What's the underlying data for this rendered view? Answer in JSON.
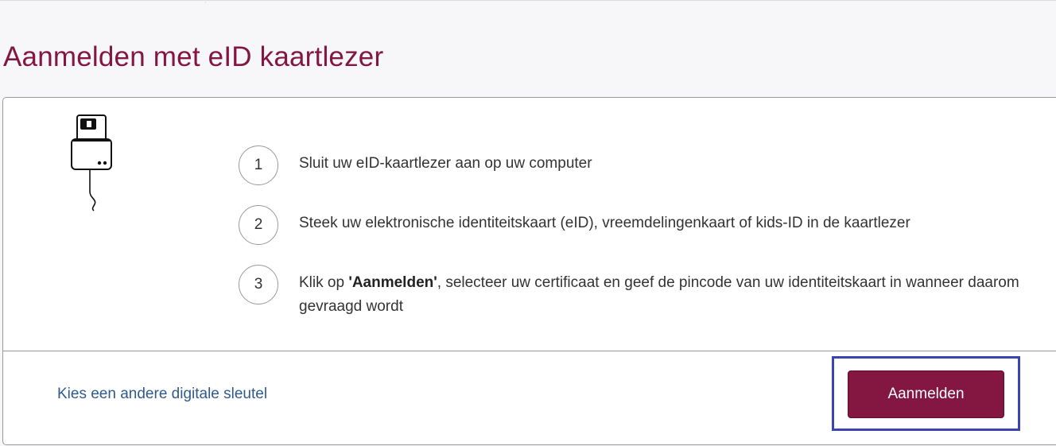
{
  "page": {
    "title": "Aanmelden met eID kaartlezer"
  },
  "illustration": {
    "icon": "card-reader-icon"
  },
  "steps": [
    {
      "number": "1",
      "text": "Sluit uw eID-kaartlezer aan op uw computer"
    },
    {
      "number": "2",
      "text": "Steek uw elektronische identiteitskaart (eID), vreemdelingenkaart of kids-ID in de kaartlezer"
    },
    {
      "number": "3",
      "text_prefix": "Klik op ",
      "text_bold": "'Aanmelden'",
      "text_suffix": ", selecteer uw certificaat en geef de pincode van uw identiteitskaart in wanneer daarom gevraagd wordt"
    }
  ],
  "footer": {
    "alt_key_link": "Kies een andere digitale sleutel",
    "login_button": "Aanmelden"
  },
  "colors": {
    "brand": "#841742",
    "link": "#2f5a8c",
    "highlight": "#3c44b0"
  }
}
